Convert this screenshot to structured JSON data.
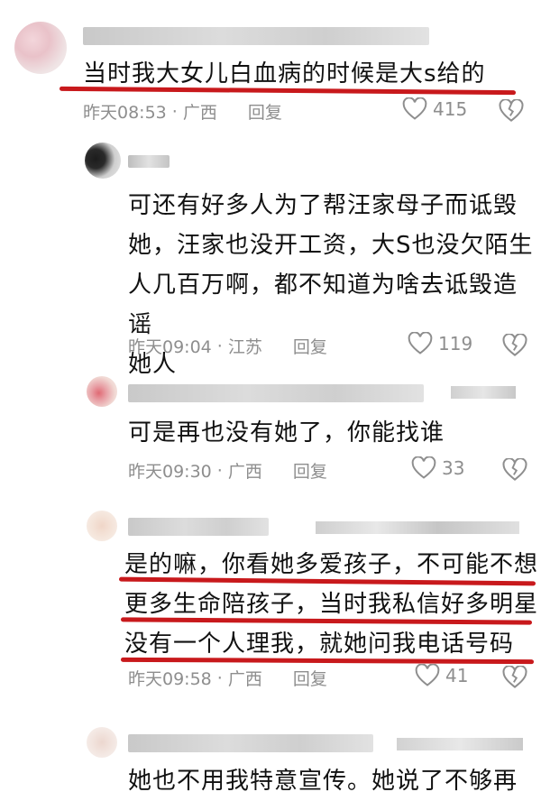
{
  "comments": [
    {
      "text_lines": [
        "当时我大女儿白血病的时候是大s给的"
      ],
      "time": "昨天08:53",
      "location": "广西",
      "reply_label": "回复",
      "likes": "415"
    },
    {
      "text_lines": [
        "可还有好多人为了帮汪家母子而诋毁",
        "她，汪家也没开工资，大S也没欠陌生",
        "人几百万啊，都不知道为啥去诋毁造谣",
        "她人"
      ],
      "time": "昨天09:04",
      "location": "江苏",
      "reply_label": "回复",
      "likes": "119"
    },
    {
      "text_lines": [
        "可是再也没有她了，你能找谁"
      ],
      "time": "昨天09:30",
      "location": "广西",
      "reply_label": "回复",
      "likes": "33"
    },
    {
      "text_lines": [
        "是的嘛，你看她多爱孩子，不可能不想",
        "更多生命陪孩子，当时我私信好多明星",
        "没有一个人理我，就她问我电话号码"
      ],
      "time": "昨天09:58",
      "location": "广西",
      "reply_label": "回复",
      "likes": "41"
    },
    {
      "text_lines": [
        "她也不用我特意宣传。她说了不够再"
      ]
    }
  ],
  "separator": "·",
  "colors": {
    "underline": "#c8191c",
    "meta": "#8e8e8e",
    "text": "#111111"
  },
  "icons": [
    "heart-outline-icon",
    "dislike-heart-icon"
  ]
}
